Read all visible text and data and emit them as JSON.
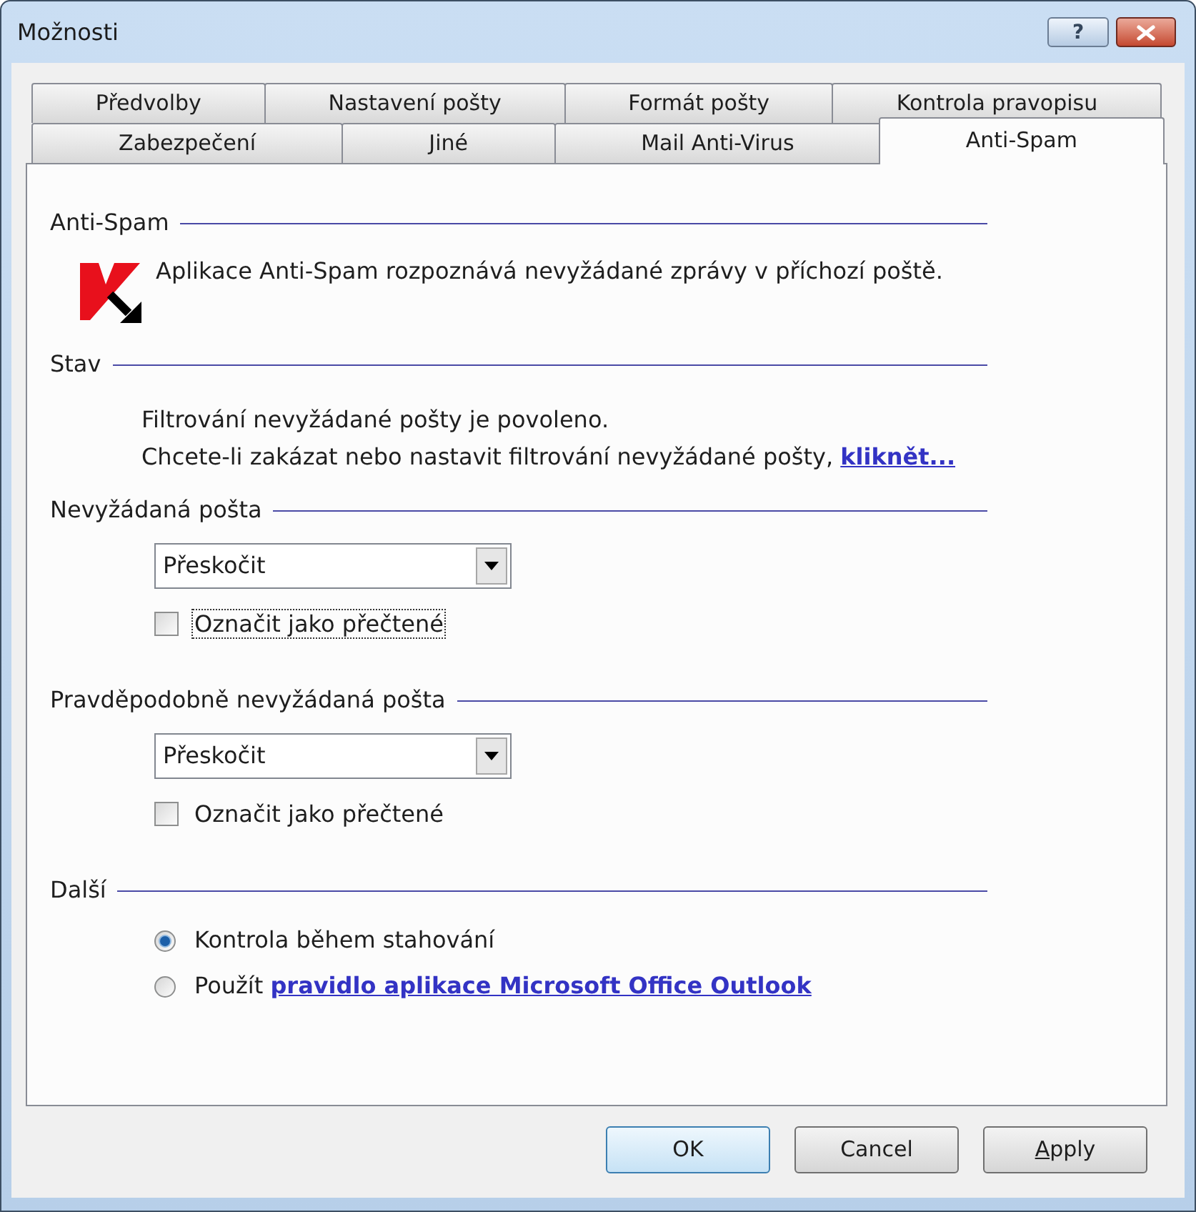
{
  "window": {
    "title": "Možnosti",
    "title_buttons": [
      {
        "kind": "help",
        "glyph": "?"
      },
      {
        "kind": "close"
      }
    ]
  },
  "tab_rows": [
    [
      {
        "label": "Předvolby",
        "selected": false
      },
      {
        "label": "Nastavení pošty",
        "selected": false
      },
      {
        "label": "Formát pošty",
        "selected": false
      },
      {
        "label": "Kontrola pravopisu",
        "selected": false
      }
    ],
    [
      {
        "label": "Zabezpečení",
        "selected": false
      },
      {
        "label": "Jiné",
        "selected": false
      },
      {
        "label": "Mail Anti-Virus",
        "selected": false
      },
      {
        "label": "Anti-Spam",
        "selected": true
      }
    ]
  ],
  "sections": [
    {
      "kind": "intro",
      "title": "Anti-Spam",
      "text": "Aplikace Anti-Spam rozpoznává nevyžádané zprávy v příchozí poště."
    },
    {
      "kind": "status",
      "title": "Stav",
      "lines": [
        {
          "text": "Filtrování nevyžádané pošty je povoleno."
        },
        {
          "text": "Chcete-li zakázat nebo nastavit filtrování nevyžádané pošty,",
          "link": "kliknět..."
        }
      ]
    },
    {
      "kind": "action",
      "title": "Nevyžádaná pošta",
      "dropdown": {
        "value": "Přeskočit"
      },
      "checkbox": {
        "label": "Označit jako přečtené",
        "checked": false,
        "focused": true
      }
    },
    {
      "kind": "action",
      "title": "Pravděpodobně nevyžádaná pošta",
      "dropdown": {
        "value": "Přeskočit"
      },
      "checkbox": {
        "label": "Označit jako přečtené",
        "checked": false,
        "focused": false
      }
    },
    {
      "kind": "options",
      "title": "Další",
      "radios": [
        {
          "label": "Kontrola během stahování",
          "selected": true
        },
        {
          "label": "Použít",
          "link": "pravidlo aplikace Microsoft Office Outlook",
          "selected": false
        }
      ]
    }
  ],
  "buttons": [
    {
      "label": "OK",
      "default": true,
      "mnemonic_underlined": false
    },
    {
      "label": "Cancel",
      "default": false,
      "mnemonic_underlined": false
    },
    {
      "label": "Apply",
      "default": false,
      "mnemonic_underlined": true
    }
  ]
}
